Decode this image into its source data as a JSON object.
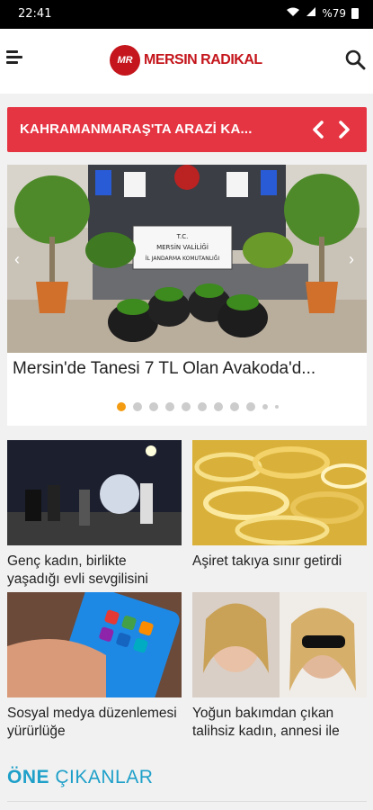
{
  "status": {
    "time": "22:41",
    "battery": "%79"
  },
  "header": {
    "brand": "MERSIN RADIKAL",
    "logo_mark": "MR"
  },
  "ticker": {
    "text": "KAHRAMANMARAŞ'TA ARAZİ KA..."
  },
  "slider": {
    "caption": "Mersin'de Tanesi 7 TL Olan Avakoda'd...",
    "sign_line1": "T.C.",
    "sign_line2": "MERSİN VALİLİĞİ",
    "sign_line3": "İL JANDARMA KOMUTANLIĞI",
    "active_index": 0,
    "dot_count": 11
  },
  "cards": [
    {
      "title": "Genç kadın, birlikte yaşadığı evli sevgilisini"
    },
    {
      "title": "Aşiret takıya sınır getirdi"
    },
    {
      "title": "Sosyal medya düzenlemesi yürürlüğe"
    },
    {
      "title": "Yoğun bakımdan çıkan talihsiz kadın, annesi ile"
    }
  ],
  "section": {
    "bold": "ÖNE",
    "light": "ÇIKANLAR"
  },
  "colors": {
    "brand_red": "#c4161c",
    "ticker_red": "#e53543",
    "accent_blue": "#1fa0c9",
    "dot_active": "#f39c12"
  }
}
